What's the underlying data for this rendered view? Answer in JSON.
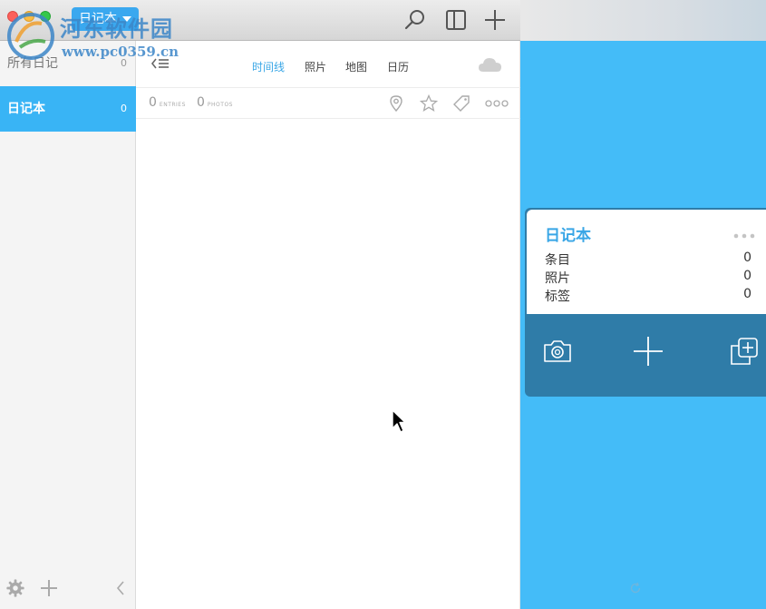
{
  "titlebar": {
    "journal_select": "日记本",
    "watermark_title": "河东软件园",
    "watermark_url": "www.pc0359.cn"
  },
  "sidebar": {
    "items": [
      {
        "label": "所有日记",
        "count": "0"
      },
      {
        "label": "日记本",
        "count": "0"
      }
    ]
  },
  "middle": {
    "tabs": [
      "时间线",
      "照片",
      "地图",
      "日历"
    ],
    "stats": {
      "entries_value": "0",
      "entries_label": "ENTRIES",
      "photos_value": "0",
      "photos_label": "PHOTOS"
    }
  },
  "card": {
    "title": "日记本",
    "rows": [
      {
        "label": "条目",
        "value": "0"
      },
      {
        "label": "照片",
        "value": "0"
      },
      {
        "label": "标签",
        "value": "0"
      }
    ]
  },
  "colors": {
    "accent": "#39b4f5",
    "right_panel": "#44bcf8",
    "card_bottom": "#2f7ca8"
  },
  "icons": [
    "search-icon",
    "sidebar-toggle-icon",
    "add-icon",
    "collapse-list-icon",
    "cloud-icon",
    "location-pin-icon",
    "star-icon",
    "tag-icon",
    "more-icon",
    "settings-gear-icon",
    "chevron-left-icon",
    "camera-icon",
    "plus-icon",
    "duplicate-icon",
    "refresh-icon"
  ]
}
